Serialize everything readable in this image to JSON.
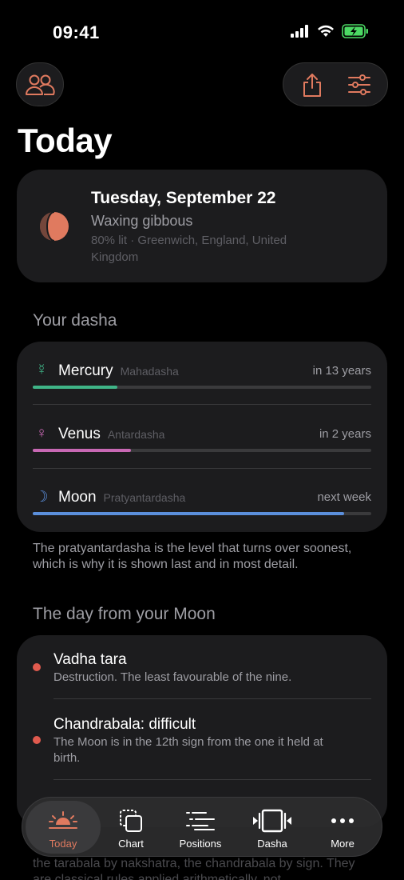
{
  "status": {
    "time": "09:41"
  },
  "colors": {
    "accent": "#e07a5f",
    "mercury": "#3fb487",
    "venus": "#c868b4",
    "moon": "#5b8fdc",
    "danger": "#e05a4e",
    "card": "#1c1c1e"
  },
  "header": {
    "left_icon": "people-icon",
    "share_icon": "share-icon",
    "filter_icon": "sliders-icon",
    "title": "Today"
  },
  "date_card": {
    "title": "Tuesday, September 22",
    "phase": "Waxing gibbous",
    "meta": "80% lit · Greenwich, England, United Kingdom"
  },
  "dasha": {
    "section_title": "Your dasha",
    "rows": [
      {
        "glyph": "☿",
        "name": "Mercury",
        "level": "Mahadasha",
        "when": "in 13 years",
        "progress": 0.25,
        "color": "#3fb487"
      },
      {
        "glyph": "♀",
        "name": "Venus",
        "level": "Antardasha",
        "when": "in 2 years",
        "progress": 0.29,
        "color": "#c868b4"
      },
      {
        "glyph": "☽",
        "name": "Moon",
        "level": "Pratyantardasha",
        "when": "next week",
        "progress": 0.92,
        "color": "#5b8fdc"
      }
    ],
    "note": "The pratyantardasha is the level that turns over soonest, which is why it is shown last and in most detail."
  },
  "moon": {
    "section_title": "The day from your Moon",
    "items": [
      {
        "title": "Vadha tara",
        "desc": "Destruction. The least favourable of the nine."
      },
      {
        "title": "Chandrabala: difficult",
        "desc": "The Moon is in the 12th sign from the one it held at birth."
      }
    ],
    "bottom_text": "the tarabala by nakshatra, the chandrabala by sign. They are classical rules applied arithmetically, not"
  },
  "tabs": [
    {
      "label": "Today",
      "icon": "sunrise-icon",
      "active": true
    },
    {
      "label": "Chart",
      "icon": "cards-icon",
      "active": false
    },
    {
      "label": "Positions",
      "icon": "list-icon",
      "active": false
    },
    {
      "label": "Dasha",
      "icon": "timeline-icon",
      "active": false
    },
    {
      "label": "More",
      "icon": "ellipsis-icon",
      "active": false
    }
  ]
}
